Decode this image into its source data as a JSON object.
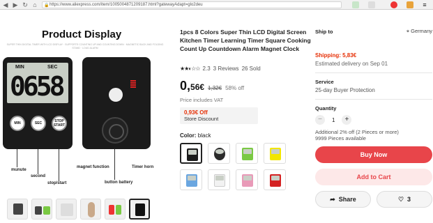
{
  "browser": {
    "url": "https://www.aliexpress.com/item/1005004871209187.html?gatewayAdapt=glo2deu",
    "nav_icons": [
      "back-arrow-icon",
      "forward-arrow-icon",
      "reload-icon",
      "home-icon"
    ]
  },
  "gallery": {
    "heading": "Product Display",
    "fine_print": "SUPER THIN DIGITAL TIMER WITH LCD DISPLAY · SUPPORTS COUNTING UP AND COUNTING DOWN · MAGNETIC BACK AND FOLDING STAND · LOUD ALARM",
    "lcd_labels": {
      "min": "MIN",
      "sec": "SEC"
    },
    "lcd_digits": "0658",
    "buttons": [
      "MIN",
      "SEC",
      "STOP START"
    ],
    "annotations": {
      "munute": "munute",
      "second": "second",
      "stop_start": "stop/start",
      "magnet": "magnet function",
      "timer_horn": "Timer horn",
      "battery": "button battery"
    },
    "thumbnail_count": 6
  },
  "product": {
    "title": "1pcs 8 Colors Super Thin LCD Digital Screen Kitchen Timer Learning Timer Square Cooking Count Up Countdown Alarm Magnet Clock",
    "rating_value": "2.3",
    "reviews": "3 Reviews",
    "sold": "26 Sold",
    "price_main": "0,",
    "price_cents": "56€",
    "price_old": "1,32€",
    "discount": "58% off",
    "vat_note": "Price includes VAT",
    "coupon_price": "0,93€ Off",
    "coupon_label": "Store Discount",
    "color_label": "Color:",
    "color_value": "black",
    "swatches": [
      {
        "name": "black",
        "color": "#1b1b1b"
      },
      {
        "name": "stopwatch",
        "color": "#2a2a2a"
      },
      {
        "name": "green",
        "color": "#7ac943"
      },
      {
        "name": "yellow",
        "color": "#f2e600"
      },
      {
        "name": "blue",
        "color": "#6aa6e0"
      },
      {
        "name": "white",
        "color": "#f2f2f2"
      },
      {
        "name": "pink",
        "color": "#e99ab8"
      },
      {
        "name": "red",
        "color": "#d42222"
      }
    ]
  },
  "sidebar": {
    "ship_to_label": "Ship to",
    "destination": "Germany",
    "shipping": "Shipping: 5,83€",
    "estimate": "Estimated delivery on Sep 01",
    "service_label": "Service",
    "service_value": "25-day Buyer Protection",
    "quantity_label": "Quantity",
    "quantity_value": "1",
    "additional": "Additional 2% off (2 Pieces or more)",
    "available": "9999 Pieces available",
    "buy_now": "Buy Now",
    "add_to_cart": "Add to Cart",
    "share": "Share",
    "wishlist_count": "3"
  },
  "colors": {
    "accent": "#e8454a",
    "price_red": "#e62e04"
  }
}
